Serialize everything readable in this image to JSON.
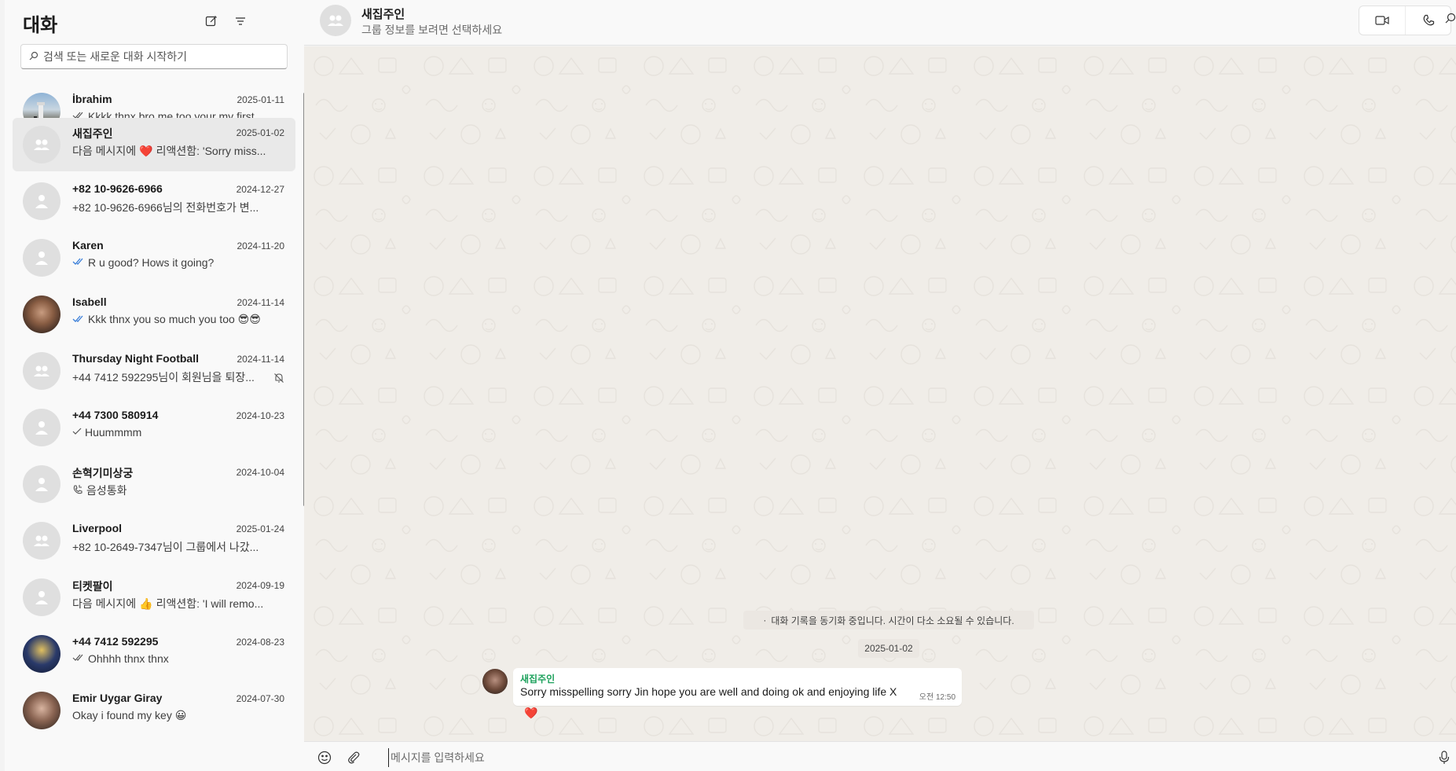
{
  "sidebar": {
    "title": "대화",
    "new_chat_icon": "compose-icon",
    "filter_icon": "filter-icon",
    "search_placeholder": "검색 또는 새로운 대화 시작하기",
    "chats": [
      {
        "name": "İbrahim",
        "date": "2025-01-11",
        "preview": "Kkkk thnx bro me too your my first...",
        "status": "read",
        "avatar": "photo-mountain"
      },
      {
        "name": "새집주인",
        "date": "2025-01-02",
        "preview_before": "다음 메시지에",
        "preview_after": "리액션함: 'Sorry miss...",
        "emoji": "❤️",
        "avatar": "group"
      },
      {
        "name": "+82 10-9626-6966",
        "date": "2024-12-27",
        "preview": "+82 10-9626-6966님의 전화번호가 변...",
        "avatar": "person"
      },
      {
        "name": "Karen",
        "date": "2024-11-20",
        "preview": "R u good? Hows it going?",
        "status": "read-blue",
        "avatar": "person"
      },
      {
        "name": "Isabell",
        "date": "2024-11-14",
        "preview": "Kkk thnx you so much you too 😎😎",
        "status": "read-blue",
        "avatar": "photo-woman"
      },
      {
        "name": "Thursday Night Football",
        "date": "2024-11-14",
        "preview": "+44 7412 592295님이 회원님을 퇴장...",
        "muted": true,
        "avatar": "group"
      },
      {
        "name": "+44 7300 580914",
        "date": "2024-10-23",
        "preview": "Huummmm",
        "status": "sent",
        "avatar": "person"
      },
      {
        "name": "손혁기미상궁",
        "date": "2024-10-04",
        "preview": "음성통화",
        "status": "call",
        "avatar": "person"
      },
      {
        "name": "Liverpool",
        "date": "2025-01-24",
        "preview": "+82 10-2649-7347님이 그룹에서 나갔...",
        "avatar": "group"
      },
      {
        "name": "티켓팔이",
        "date": "2024-09-19",
        "preview_before": "다음 메시지에",
        "preview_after": "리액션함: 'I will remo...",
        "emoji": "👍",
        "avatar": "person"
      },
      {
        "name": "+44 7412 592295",
        "date": "2024-08-23",
        "preview": "Ohhhh thnx thnx",
        "status": "read",
        "avatar": "photo-football"
      },
      {
        "name": "Emir Uygar Giray",
        "date": "2024-07-30",
        "preview": "Okay i found my key 😀",
        "avatar": "photo-man"
      }
    ]
  },
  "header": {
    "group_name": "새집주인",
    "subtitle": "그룹 정보를 보려면 선택하세요",
    "video_icon": "video-call-icon",
    "phone_icon": "phone-call-icon",
    "search_icon": "search-icon"
  },
  "conversation": {
    "sync_notice": "대화 기록을 동기화 중입니다. 시간이 다소 소요될 수 있습니다.",
    "date_chip": "2025-01-02",
    "message": {
      "sender": "새집주인",
      "text": "Sorry misspelling sorry Jin hope you are well and doing ok and enjoying life X",
      "time": "오전 12:50",
      "reaction": "❤️"
    }
  },
  "composer": {
    "placeholder": "메시지를 입력하세요",
    "emoji_icon": "emoji-icon",
    "attach_icon": "attach-icon",
    "mic_icon": "microphone-icon"
  },
  "colors": {
    "accent_green": "#1aa05a",
    "read_blue": "#3b7fd9",
    "chat_bg": "#f0ede8"
  }
}
